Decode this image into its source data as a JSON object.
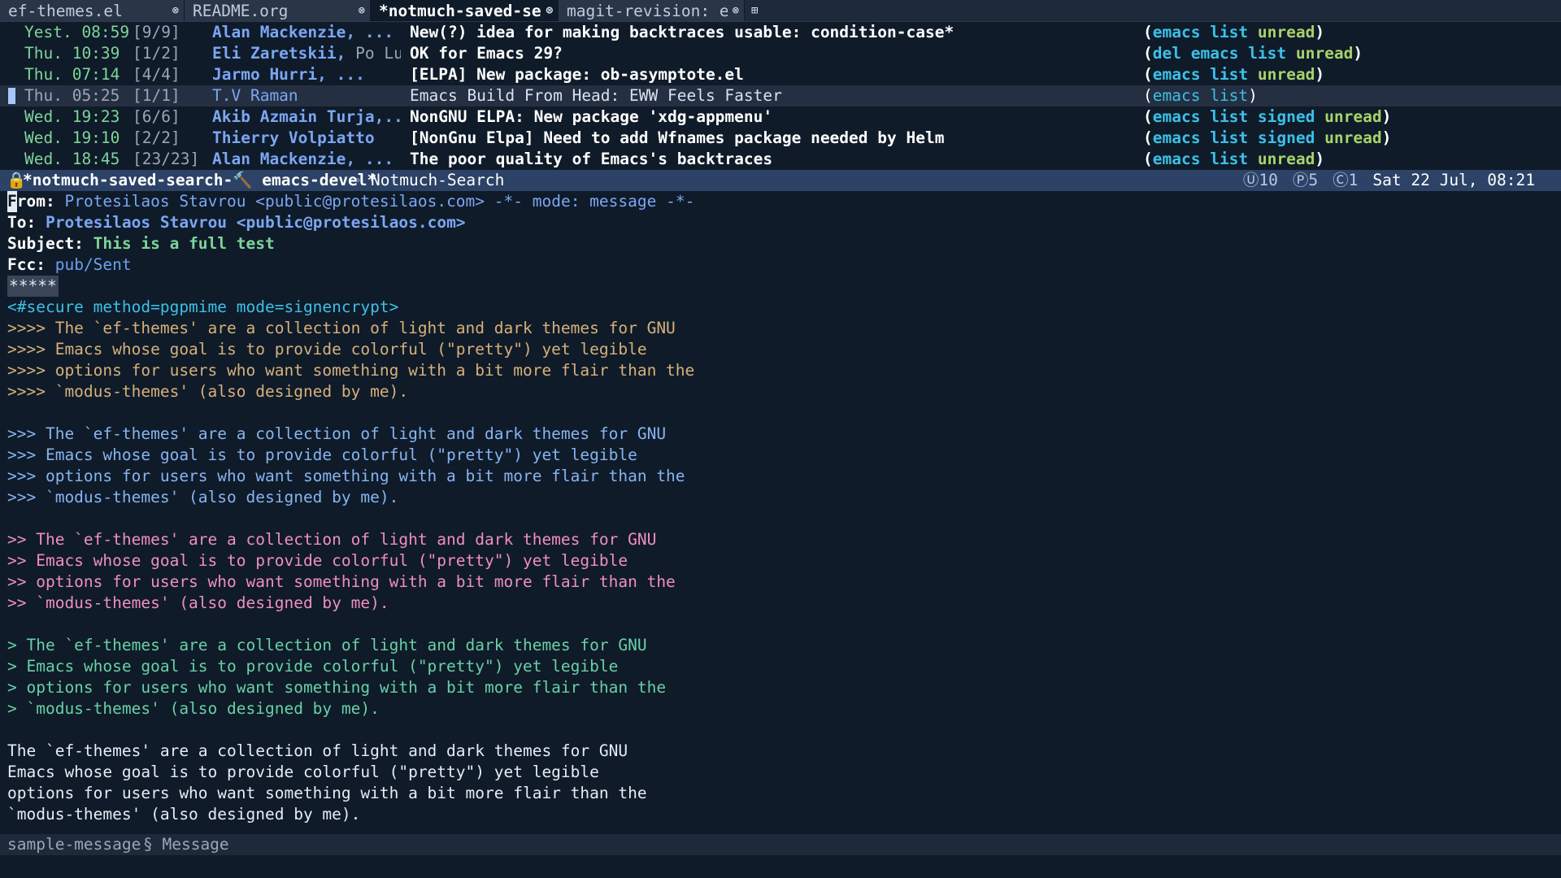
{
  "tabs": [
    {
      "label": "ef-themes.el",
      "active": false
    },
    {
      "label": "README.org",
      "active": false
    },
    {
      "label": "*notmuch-saved-sea",
      "active": true
    },
    {
      "label": "magit-revision: ef",
      "active": false
    }
  ],
  "tab_close_glyph": "⊗",
  "tab_new_glyph": "⊞",
  "search_rows": [
    {
      "date": "Yest. 08:59",
      "count": "[9/9]",
      "authors": "Alan Mackenzie, ...",
      "authors_dim": "",
      "subject": "New(?) idea for making backtraces usable: condition-case*",
      "tags": [
        {
          "t": "emacs",
          "c": "emacs"
        },
        {
          "t": "list",
          "c": "list"
        },
        {
          "t": "unread",
          "c": "unread"
        }
      ],
      "current": false
    },
    {
      "date": "Thu. 10:39",
      "count": "[1/2]",
      "authors": "Eli Zaretskii,",
      "authors_dim": " Po Lu",
      "subject": "OK for Emacs 29?",
      "tags": [
        {
          "t": "del",
          "c": "del"
        },
        {
          "t": "emacs",
          "c": "emacs"
        },
        {
          "t": "list",
          "c": "list"
        },
        {
          "t": "unread",
          "c": "unread"
        }
      ],
      "current": false
    },
    {
      "date": "Thu. 07:14",
      "count": "[4/4]",
      "authors": "Jarmo Hurri, ...",
      "authors_dim": "",
      "subject": "[ELPA] New package: ob-asymptote.el",
      "tags": [
        {
          "t": "emacs",
          "c": "emacs"
        },
        {
          "t": "list",
          "c": "list"
        },
        {
          "t": "unread",
          "c": "unread"
        }
      ],
      "current": false
    },
    {
      "date": "Thu. 05:25",
      "count": "[1/1]",
      "authors": "T.V Raman",
      "authors_dim": "",
      "subject": "Emacs Build From Head: EWW Feels Faster",
      "tags": [
        {
          "t": "emacs",
          "c": "emacs"
        },
        {
          "t": "list",
          "c": "list"
        }
      ],
      "current": true
    },
    {
      "date": "Wed. 19:23",
      "count": "[6/6]",
      "authors": "Akib Azmain Turja,...",
      "authors_dim": "",
      "subject": "NonGNU ELPA: New package 'xdg-appmenu'",
      "tags": [
        {
          "t": "emacs",
          "c": "emacs"
        },
        {
          "t": "list",
          "c": "list"
        },
        {
          "t": "signed",
          "c": "signed"
        },
        {
          "t": "unread",
          "c": "unread"
        }
      ],
      "current": false
    },
    {
      "date": "Wed. 19:10",
      "count": "[2/2]",
      "authors": "Thierry Volpiatto",
      "authors_dim": "",
      "subject": "[NonGnu Elpa] Need to add Wfnames package needed by Helm",
      "tags": [
        {
          "t": "emacs",
          "c": "emacs"
        },
        {
          "t": "list",
          "c": "list"
        },
        {
          "t": "signed",
          "c": "signed"
        },
        {
          "t": "unread",
          "c": "unread"
        }
      ],
      "current": false
    },
    {
      "date": "Wed. 18:45",
      "count": "[23/23]",
      "authors": "Alan Mackenzie, ...",
      "authors_dim": "",
      "subject": "The poor quality of Emacs's backtraces",
      "tags": [
        {
          "t": "emacs",
          "c": "emacs"
        },
        {
          "t": "list",
          "c": "list"
        },
        {
          "t": "unread",
          "c": "unread"
        }
      ],
      "current": false
    }
  ],
  "modeline": {
    "lock_glyph": "🔒",
    "buffer": "*notmuch-saved-search-🔨 emacs-devel*",
    "sep_glyph": "∘",
    "mode": "Notmuch-Search",
    "indicators": [
      "Ⓤ10",
      "Ⓟ5",
      "Ⓒ1"
    ],
    "datetime": "Sat 22 Jul, 08:21"
  },
  "message": {
    "from_key": "From:",
    "from_val": "Protesilaos Stavrou <public@protesilaos.com>",
    "mode_note": "-*- mode: message -*-",
    "to_key": "To:",
    "to_val": "Protesilaos Stavrou <public@protesilaos.com>",
    "subject_key": "Subject:",
    "subject_val": "This is a full test",
    "fcc_key": "Fcc:",
    "fcc_val": "pub/Sent",
    "separator": "*****",
    "secure": "<#secure method=pgpmime mode=signencrypt>",
    "q4": [
      ">>>> The `ef-themes' are a collection of light and dark themes for GNU",
      ">>>> Emacs whose goal is to provide colorful (\"pretty\") yet legible",
      ">>>> options for users who want something with a bit more flair than the",
      ">>>> `modus-themes' (also designed by me)."
    ],
    "q3": [
      ">>> The `ef-themes' are a collection of light and dark themes for GNU",
      ">>> Emacs whose goal is to provide colorful (\"pretty\") yet legible",
      ">>> options for users who want something with a bit more flair than the",
      ">>> `modus-themes' (also designed by me)."
    ],
    "q2": [
      ">> The `ef-themes' are a collection of light and dark themes for GNU",
      ">> Emacs whose goal is to provide colorful (\"pretty\") yet legible",
      ">> options for users who want something with a bit more flair than the",
      ">> `modus-themes' (also designed by me)."
    ],
    "q1": [
      "> The `ef-themes' are a collection of light and dark themes for GNU",
      "> Emacs whose goal is to provide colorful (\"pretty\") yet legible",
      "> options for users who want something with a bit more flair than the",
      "> `modus-themes' (also designed by me)."
    ],
    "q0": [
      "The `ef-themes' are a collection of light and dark themes for GNU",
      "Emacs whose goal is to provide colorful (\"pretty\") yet legible",
      "options for users who want something with a bit more flair than the",
      "`modus-themes' (also designed by me)."
    ]
  },
  "footer": {
    "buffer": "sample-message",
    "mode": "§ Message"
  },
  "colors": {
    "background": "#0f1b29",
    "modeline_active": "#2c4266",
    "tag_blue": "#3cc0e8",
    "tag_green": "#a8d26a",
    "quote4": "#d7b07a",
    "quote3": "#87b4f0",
    "quote2": "#f08ec2",
    "quote1": "#68d0a6"
  }
}
